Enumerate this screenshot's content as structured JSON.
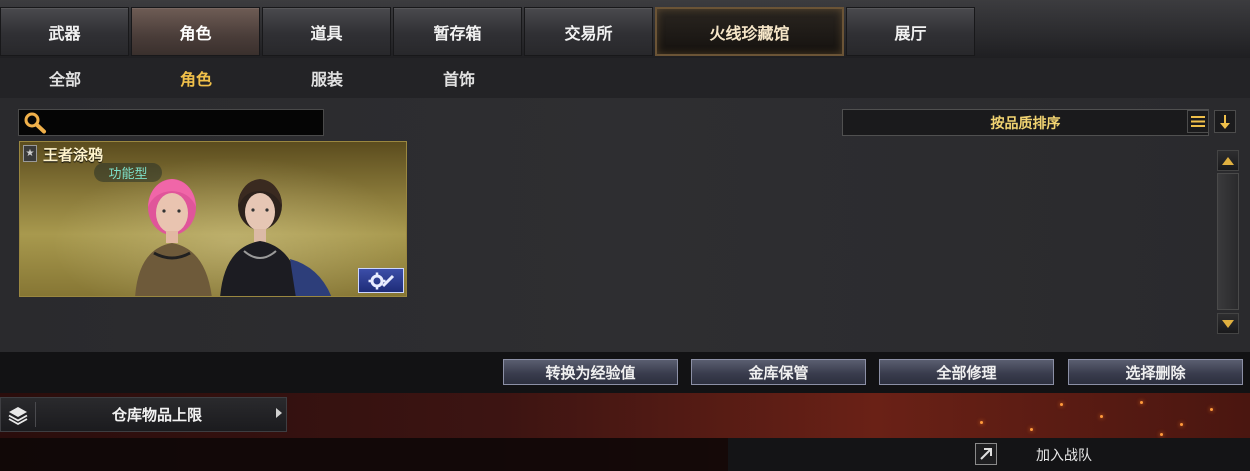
{
  "top_tabs": [
    {
      "label": "武器"
    },
    {
      "label": "角色",
      "active": true
    },
    {
      "label": "道具"
    },
    {
      "label": "暂存箱"
    },
    {
      "label": "交易所"
    },
    {
      "label": "火线珍藏馆",
      "special": true
    },
    {
      "label": "展厅"
    }
  ],
  "sub_tabs": [
    {
      "label": "全部"
    },
    {
      "label": "角色",
      "active": true
    },
    {
      "label": "服装"
    },
    {
      "label": "首饰"
    }
  ],
  "search": {
    "value": ""
  },
  "sort": {
    "label": "按品质排序"
  },
  "item": {
    "name": "王者涂鸦",
    "type": "功能型",
    "rank_icon": "star-rank-icon"
  },
  "actions": [
    "转换为经验值",
    "金库保管",
    "全部修理",
    "选择删除"
  ],
  "storage_limit": {
    "label": "仓库物品上限"
  },
  "join": {
    "label": "加入战队"
  },
  "colors": {
    "accent_gold": "#f0c04a",
    "sort_text": "#f2d472",
    "type_text": "#7ee0c8"
  }
}
